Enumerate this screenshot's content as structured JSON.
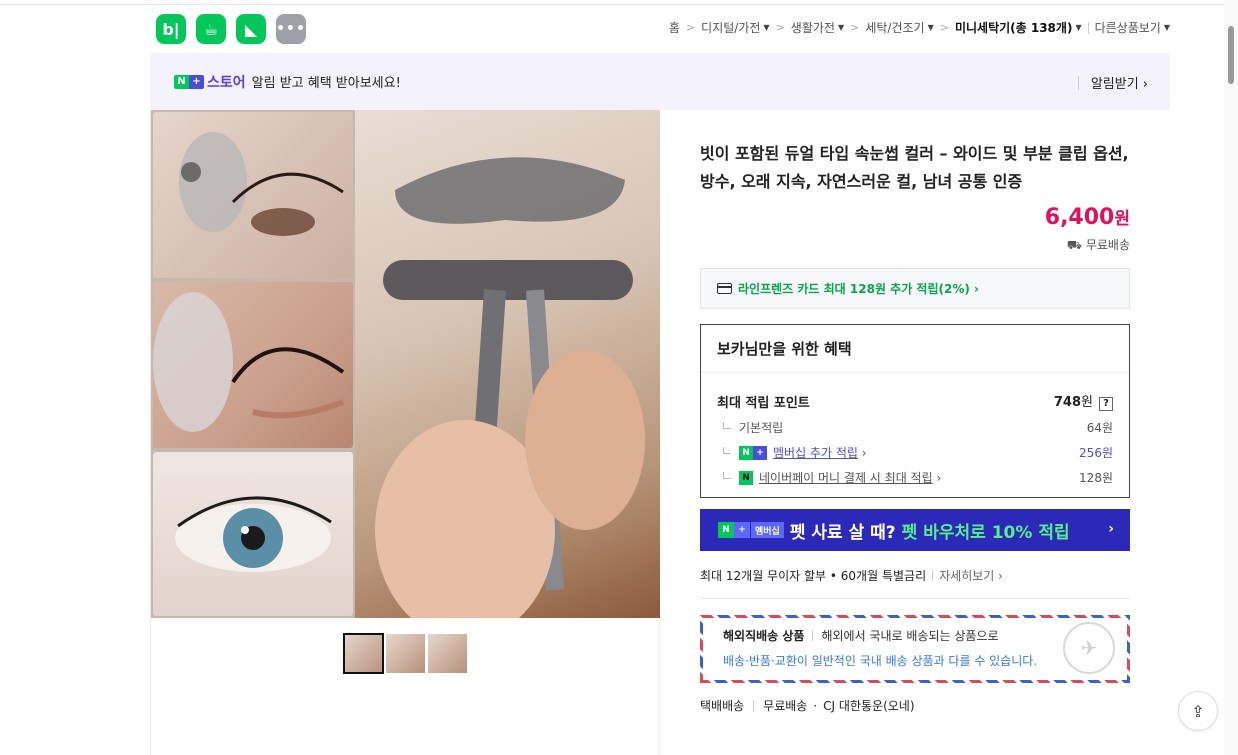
{
  "apps": [
    {
      "label": "b|",
      "icon": "naver-blog-icon"
    },
    {
      "label": "☕",
      "icon": "naver-cafe-icon"
    },
    {
      "label": "◣",
      "icon": "naver-map-icon"
    },
    {
      "label": "•••",
      "icon": "more-apps-icon"
    }
  ],
  "breadcrumb": {
    "home": "홈",
    "items": [
      "디지털/가전",
      "생활가전",
      "세탁/건조기"
    ],
    "current": "미니세탁기",
    "current_count": "(총 138개)",
    "other": "다른상품보기"
  },
  "banner": {
    "badge_n": "N",
    "badge_plus": "+",
    "store": "스토어",
    "text": "알림 받고 혜택 받아보세요!",
    "alarm_button": "알림받기 ›"
  },
  "product": {
    "title": "빗이 포함된 듀얼 타입 속눈썹 컬러 – 와이드 및 부분 클립 옵션, 방수, 오래 지속, 자연스러운 컬, 남녀 공통 인증",
    "price": "6,400",
    "price_unit": "원",
    "shipping": "무료배송",
    "card_benefit": "라인프렌즈 카드 최대 128원 추가 적립(2%) ›"
  },
  "benefits": {
    "heading": "보카님만을 위한 혜택",
    "max_label": "최대 적립 포인트",
    "max_value": "748",
    "max_unit": "원",
    "help": "?",
    "basic_label": "기본적립",
    "basic_value": "64원",
    "membership_label": "멤버십 추가 적립",
    "membership_value": "256원",
    "naverpay_label": "네이버페이 머니 결제 시 최대 적립",
    "naverpay_value": "128원"
  },
  "promo": {
    "tag_membership": "멤버십",
    "text": "펫 사료 살 때?",
    "highlight": "펫 바우처로 10% 적립",
    "arrow": "›"
  },
  "installment": {
    "text": "최대 12개월 무이자 할부 • 60개월 특별금리",
    "more": "자세히보기 ›"
  },
  "overseas": {
    "title": "해외직배송 상품",
    "desc": "해외에서 국내로 배송되는 상품으로",
    "note": "배송·반품·교환이 일반적인 국내 배송 상품과 다를 수 있습니다."
  },
  "delivery": {
    "method": "택배배송",
    "fee": "무료배송",
    "carrier": "CJ 대한통운(오네)"
  },
  "share": {
    "icon": "share-icon"
  }
}
